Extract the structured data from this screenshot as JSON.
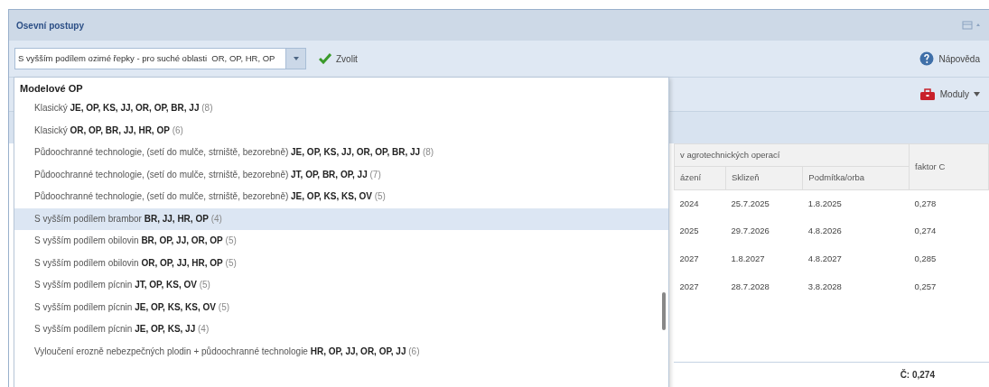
{
  "panel": {
    "title": "Osevní postupy"
  },
  "toolbar": {
    "combo_value": "S vyšším podílem ozimé řepky - pro suché oblasti  OR, OP, HR, OP",
    "choose_button": "Zvolit",
    "help_button": "Nápověda"
  },
  "modules_button": "Moduly",
  "dropdown": {
    "group": "Modelové OP",
    "items": [
      {
        "label": "Klasický",
        "crops": "JE, OP, KS, JJ, OR, OP, BR, JJ",
        "count": "(8)",
        "selected": false
      },
      {
        "label": "Klasický",
        "crops": "OR, OP, BR, JJ, HR, OP",
        "count": "(6)",
        "selected": false
      },
      {
        "label": "Půdoochranné technologie, (setí do mulče, strniště, bezorebně)",
        "crops": "JE, OP, KS, JJ, OR, OP, BR, JJ",
        "count": "(8)",
        "selected": false
      },
      {
        "label": "Půdoochranné technologie, (setí do mulče, strniště, bezorebně)",
        "crops": "JT, OP, BR, OP, JJ",
        "count": "(7)",
        "selected": false
      },
      {
        "label": "Půdoochranné technologie, (setí do mulče, strniště, bezorebně)",
        "crops": "JE, OP, KS, KS, OV",
        "count": "(5)",
        "selected": false
      },
      {
        "label": "S vyšším podílem brambor",
        "crops": "BR, JJ, HR, OP",
        "count": "(4)",
        "selected": true
      },
      {
        "label": "S vyšším podílem obilovin",
        "crops": "BR, OP, JJ, OR, OP",
        "count": "(5)",
        "selected": false
      },
      {
        "label": "S vyšším podílem obilovin",
        "crops": "OR, OP, JJ, HR, OP",
        "count": "(5)",
        "selected": false
      },
      {
        "label": "S vyšším podílem pícnin",
        "crops": "JT, OP, KS, OV",
        "count": "(5)",
        "selected": false
      },
      {
        "label": "S vyšším podílem pícnin",
        "crops": "JE, OP, KS, KS, OV",
        "count": "(5)",
        "selected": false
      },
      {
        "label": "S vyšším podílem pícnin",
        "crops": "JE, OP, KS, JJ",
        "count": "(4)",
        "selected": false
      },
      {
        "label": "Vyloučení erozně nebezpečných plodin + půdoochranné technologie",
        "crops": "HR, OP, JJ, OR, OP, JJ",
        "count": "(6)",
        "selected": false
      }
    ]
  },
  "table": {
    "group_header": "v agrotechnických operací",
    "columns": [
      "ázení",
      "Sklizeň",
      "Podmítka/orba",
      "faktor C"
    ],
    "rows": [
      [
        "2024",
        "25.7.2025",
        "1.8.2025",
        "0,278"
      ],
      [
        "2025",
        "29.7.2026",
        "4.8.2026",
        "0,274"
      ],
      [
        "2027",
        "1.8.2027",
        "4.8.2027",
        "0,285"
      ],
      [
        "2027",
        "28.7.2028",
        "3.8.2028",
        "0,257"
      ]
    ],
    "total": "Č: 0,274"
  }
}
